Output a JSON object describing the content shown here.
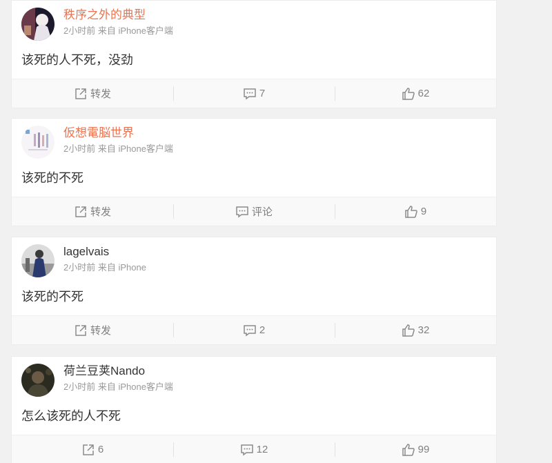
{
  "posts": [
    {
      "user": "秩序之外的典型",
      "meta": "2小时前 来自 iPhone客户端",
      "text": "该死的人不死，没劲",
      "repost": "转发",
      "comment": "7",
      "like": "62"
    },
    {
      "user": "仮想電脳世界",
      "meta": "2小时前 来自 iPhone客户端",
      "text": "该死的不死",
      "repost": "转发",
      "comment": "评论",
      "like": "9"
    },
    {
      "user": "lagelvais",
      "meta": "2小时前 来自 iPhone",
      "text": "该死的不死",
      "repost": "转发",
      "comment": "2",
      "like": "32"
    },
    {
      "user": "荷兰豆荚Nando",
      "meta": "2小时前 来自 iPhone客户端",
      "text": "怎么该死的人不死",
      "repost": "6",
      "comment": "12",
      "like": "99"
    }
  ],
  "icons": {
    "repost": "repost-icon",
    "comment": "comment-icon",
    "like": "thumbs-up-icon"
  },
  "colors": {
    "username_vip": "#eb7350",
    "username_plain": "#333333",
    "meta": "#999999",
    "action_text": "#808080",
    "page_bg": "#f1f1f1"
  }
}
